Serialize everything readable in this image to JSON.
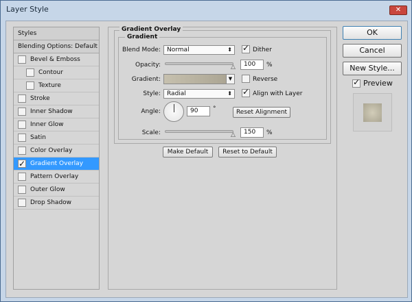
{
  "window": {
    "title": "Layer Style",
    "close_icon": "close-icon"
  },
  "sidebar": {
    "items": [
      {
        "label": "Styles",
        "checkbox": false
      },
      {
        "label": "Blending Options: Default",
        "checkbox": false
      },
      {
        "label": "Bevel & Emboss",
        "checkbox": true,
        "checked": false
      },
      {
        "label": "Contour",
        "checkbox": true,
        "checked": false,
        "indent": true
      },
      {
        "label": "Texture",
        "checkbox": true,
        "checked": false,
        "indent": true
      },
      {
        "label": "Stroke",
        "checkbox": true,
        "checked": false
      },
      {
        "label": "Inner Shadow",
        "checkbox": true,
        "checked": false
      },
      {
        "label": "Inner Glow",
        "checkbox": true,
        "checked": false
      },
      {
        "label": "Satin",
        "checkbox": true,
        "checked": false
      },
      {
        "label": "Color Overlay",
        "checkbox": true,
        "checked": false
      },
      {
        "label": "Gradient Overlay",
        "checkbox": true,
        "checked": true,
        "selected": true
      },
      {
        "label": "Pattern Overlay",
        "checkbox": true,
        "checked": false
      },
      {
        "label": "Outer Glow",
        "checkbox": true,
        "checked": false
      },
      {
        "label": "Drop Shadow",
        "checkbox": true,
        "checked": false
      }
    ]
  },
  "panel": {
    "section_title": "Gradient Overlay",
    "group_title": "Gradient",
    "blend_mode": {
      "label": "Blend Mode:",
      "value": "Normal"
    },
    "dither": {
      "label": "Dither",
      "checked": true
    },
    "opacity": {
      "label": "Opacity:",
      "value": "100",
      "unit": "%",
      "percent": 100
    },
    "gradient": {
      "label": "Gradient:",
      "colors": [
        "#c6c0ae",
        "#a8a290"
      ]
    },
    "reverse": {
      "label": "Reverse",
      "checked": false
    },
    "style": {
      "label": "Style:",
      "value": "Radial"
    },
    "align": {
      "label": "Align with Layer",
      "checked": true
    },
    "angle": {
      "label": "Angle:",
      "value": "90",
      "unit": "°"
    },
    "reset_alignment": "Reset Alignment",
    "scale": {
      "label": "Scale:",
      "value": "150",
      "unit": "%",
      "percent": 100
    },
    "make_default": "Make Default",
    "reset_default": "Reset to Default"
  },
  "actions": {
    "ok": "OK",
    "cancel": "Cancel",
    "new_style": "New Style...",
    "preview": {
      "label": "Preview",
      "checked": true
    }
  },
  "colors": {
    "selected": "#3399ff",
    "swatch": "#c2bda9"
  }
}
